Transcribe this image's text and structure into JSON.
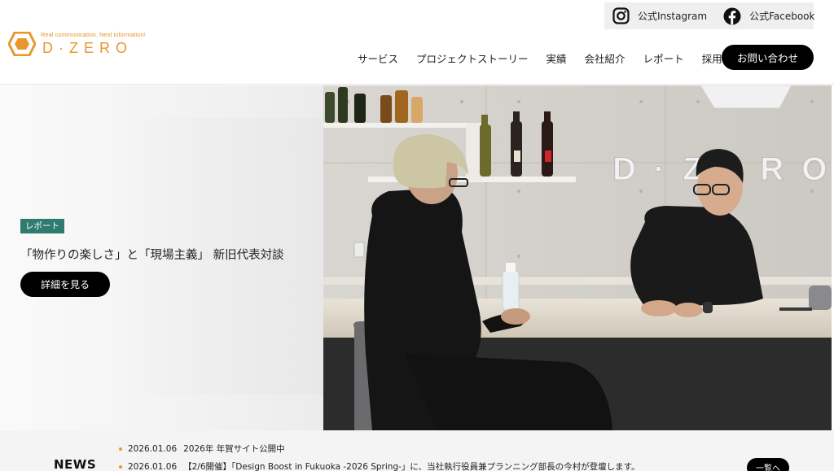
{
  "brand": {
    "tagline": "Real communication, Next information!",
    "wordmark": "D·ZERO",
    "accent_color": "#e8972e"
  },
  "social": {
    "instagram_label": "公式Instagram",
    "instagram_icon": "instagram-icon",
    "facebook_label": "公式Facebook",
    "facebook_icon": "facebook-icon"
  },
  "nav": {
    "items": [
      "サービス",
      "プロジェクトストーリー",
      "実績",
      "会社紹介",
      "レポート",
      "採用情報"
    ],
    "contact_label": "お問い合わせ"
  },
  "hero": {
    "tag": "レポート",
    "tag_color": "#2e7b70",
    "title": "「物作りの楽しさ」と「現場主義」 新旧代表対談",
    "button_label": "詳細を見る",
    "photo_wall_sign": "D·ZERO"
  },
  "news": {
    "heading": "NEWS",
    "more_label": "一覧へ",
    "items": [
      {
        "date": "2026.01.06",
        "text": "2026年 年賀サイト公開中"
      },
      {
        "date": "2026.01.06",
        "text": "【2/6開催】「Design Boost in Fukuoka -2026 Spring-」に、当社執行役員兼プランニング部長の今村が登壇します。"
      }
    ]
  }
}
